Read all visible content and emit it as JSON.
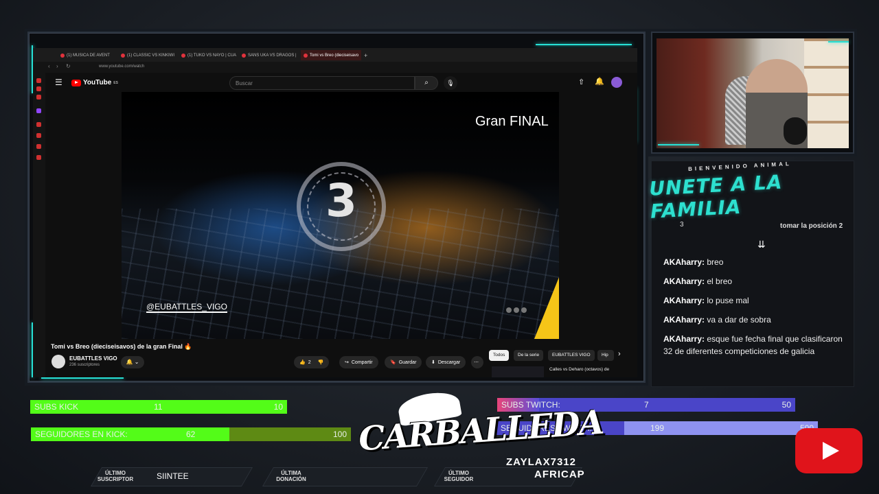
{
  "browser": {
    "tabs": [
      {
        "label": "(1) MUSICA DE AVENT"
      },
      {
        "label": "(1) CLASSIC VS KINKIWI"
      },
      {
        "label": "(1) TUKO VS NAYO | CUA"
      },
      {
        "label": "SANS UKA VS DRAGOS |"
      },
      {
        "label": "Tomi vs Breo (dieciseisavo"
      }
    ],
    "address": "www.youtube.com/watch"
  },
  "youtube": {
    "logo_text": "YouTube",
    "logo_sup": "ES",
    "search_placeholder": "Buscar",
    "video": {
      "overlay_title": "Gran FINAL",
      "countdown": "3",
      "watermark": "@EUBATTLES_VIGO"
    },
    "video_title": "Tomi vs Breo (dieciseisavos) de la gran Final 🔥",
    "channel_name": "EUBATTLES VIGO",
    "channel_subs": "236 suscriptores",
    "likes": "2",
    "share_label": "Compartir",
    "save_label": "Guardar",
    "download_label": "Descargar",
    "chips": [
      "Todos",
      "De la serie",
      "EUBATTLES VIGO",
      "Hip"
    ],
    "next_video_title": "Calles vs Deharo (octavos) de"
  },
  "chat": {
    "welcome": "BIENVENIDO ANIMAL",
    "header": "UNETE A LA FAMILIA",
    "cutoff_left": "3",
    "cutoff_text": "tomar la posición 2",
    "messages": [
      {
        "user": "AKAharry:",
        "text": "breo"
      },
      {
        "user": "AKAharry:",
        "text": "el breo"
      },
      {
        "user": "AKAharry:",
        "text": "lo puse mal"
      },
      {
        "user": "AKAharry:",
        "text": "va a dar de sobra"
      },
      {
        "user": "AKAharry:",
        "text": "esque fue fecha final que clasificaron 32 de diferentes competiciones de galicia"
      }
    ]
  },
  "goals": {
    "subs_kick": {
      "label": "SUBS KICK",
      "current": "11",
      "max": "10",
      "fraction": 1.0
    },
    "seguidores_kick": {
      "label": "SEGUIDORES EN KICK:",
      "current": "62",
      "max": "100",
      "fraction": 0.62
    },
    "subs_twitch": {
      "label": "SUBS TWITCH:",
      "current": "7",
      "max": "50",
      "fraction": 0.14
    },
    "seguidores_twitch": {
      "label": "SEGUIDORES TWITCH:",
      "current": "199",
      "max": "500",
      "fraction": 0.398
    }
  },
  "logo_text": "CARBALLEDA",
  "bottom": {
    "ultimo_suscriptor_label": "ÚLTIMO SUSCRIPTOR",
    "ultimo_suscriptor": "SIINTEE",
    "ultima_donacion_label": "ÚLTIMA DONACIÓN",
    "ultima_donacion": "",
    "ultimo_seguidor_label": "ÚLTIMO SEGUIDOR",
    "ultimo_seguidor_1": "ZAYLAX7312",
    "ultimo_seguidor_2": "AFRICAP"
  },
  "colors": {
    "accent_cyan": "#27e1d6",
    "kick_green": "#53fc18",
    "twitch_purple": "#5b4fd9",
    "youtube_red": "#ff0000"
  }
}
